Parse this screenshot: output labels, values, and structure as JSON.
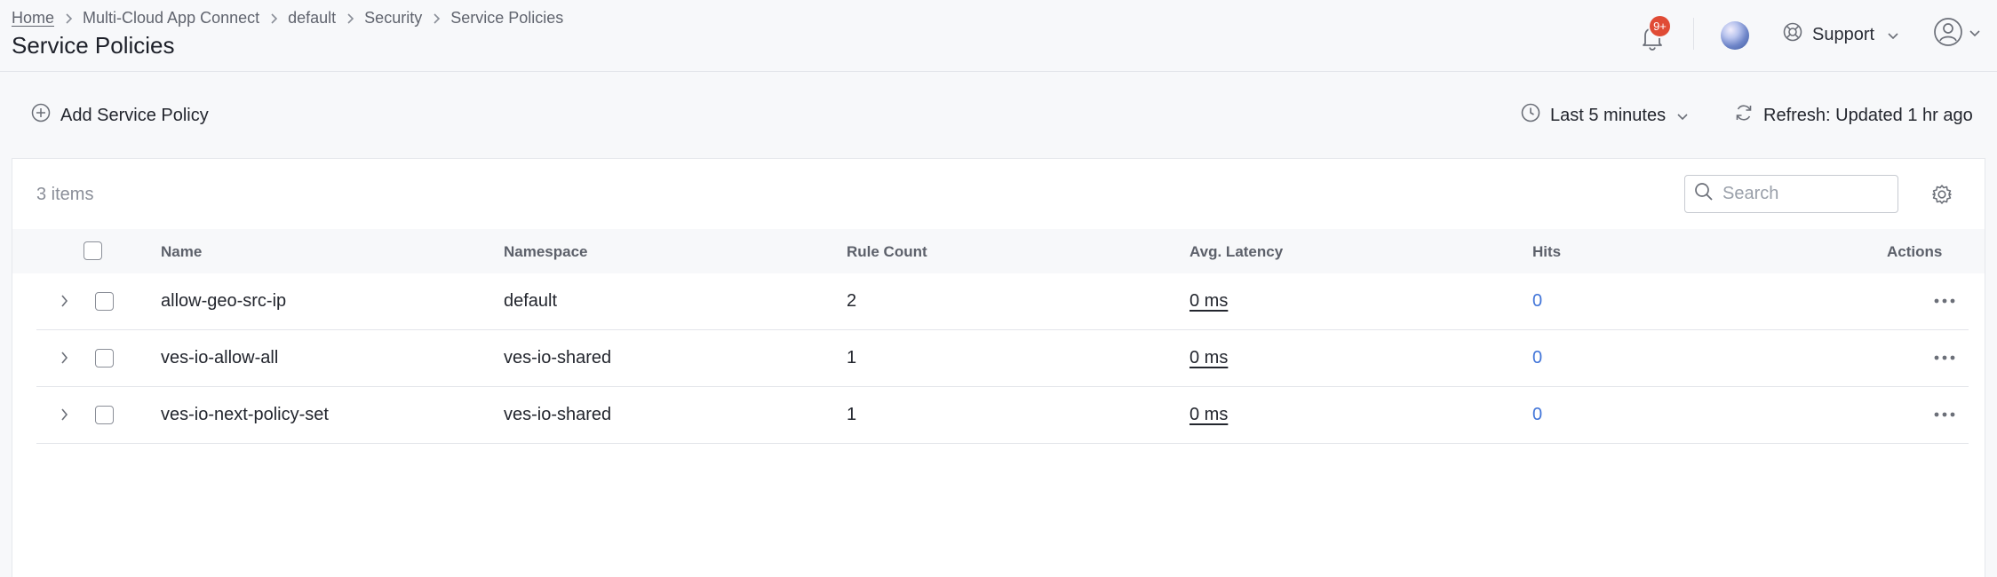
{
  "breadcrumb": {
    "items": [
      "Home",
      "Multi-Cloud App Connect",
      "default",
      "Security",
      "Service Policies"
    ]
  },
  "page_title": "Service Policies",
  "header": {
    "notification_badge": "9+",
    "support_label": "Support"
  },
  "toolbar": {
    "add_label": "Add Service Policy",
    "time_range_label": "Last 5 minutes",
    "refresh_label": "Refresh: Updated 1 hr ago"
  },
  "table": {
    "count_label": "3 items",
    "search_placeholder": "Search",
    "columns": [
      "Name",
      "Namespace",
      "Rule Count",
      "Avg. Latency",
      "Hits",
      "Actions"
    ],
    "rows": [
      {
        "name": "allow-geo-src-ip",
        "namespace": "default",
        "rule_count": "2",
        "avg_latency": "0 ms",
        "hits": "0"
      },
      {
        "name": "ves-io-allow-all",
        "namespace": "ves-io-shared",
        "rule_count": "1",
        "avg_latency": "0 ms",
        "hits": "0"
      },
      {
        "name": "ves-io-next-policy-set",
        "namespace": "ves-io-shared",
        "rule_count": "1",
        "avg_latency": "0 ms",
        "hits": "0"
      }
    ]
  },
  "colors": {
    "badge": "#e04b35",
    "link": "#3f73d8"
  }
}
